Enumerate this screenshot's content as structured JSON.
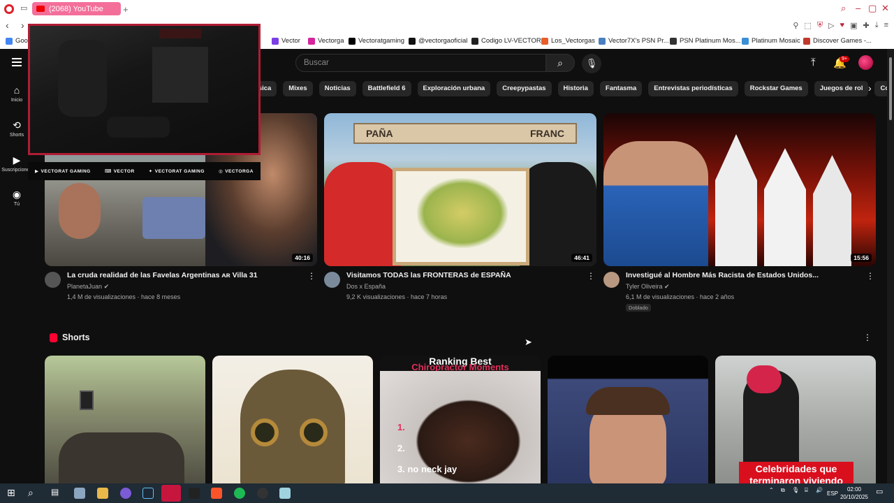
{
  "browser": {
    "tab_title": "(2068) YouTube",
    "new_tab": "+",
    "bookmarks": [
      {
        "label": "Goo",
        "color": "#4285f4"
      },
      {
        "label": "Vector",
        "color": "#7b3fe4"
      },
      {
        "label": "Vectorga",
        "color": "#d6249f"
      },
      {
        "label": "Vectoratgaming",
        "color": "#000000"
      },
      {
        "label": "@vectorgaoficial",
        "color": "#111111"
      },
      {
        "label": "Codigo LV-VECTOR",
        "color": "#222222"
      },
      {
        "label": "Los_Vectorgas",
        "color": "#e85d2a"
      },
      {
        "label": "Vector7X's PSN Pr...",
        "color": "#4a7fc1"
      },
      {
        "label": "PSN Platinum Mos...",
        "color": "#333333"
      },
      {
        "label": "Platinum Mosaic",
        "color": "#3a8fd6"
      },
      {
        "label": "Discover Games -...",
        "color": "#c0392b"
      }
    ]
  },
  "youtube": {
    "search_placeholder": "Buscar",
    "notifications_badge": "9+",
    "sidebar": [
      {
        "label": "Inicio",
        "icon": "home-icon"
      },
      {
        "label": "Shorts",
        "icon": "shorts-icon"
      },
      {
        "label": "Suscripciones",
        "icon": "subscriptions-icon"
      },
      {
        "label": "Tú",
        "icon": "you-icon"
      }
    ],
    "chips": [
      "úsica",
      "Mixes",
      "Noticias",
      "Battlefield 6",
      "Exploración urbana",
      "Creepypastas",
      "Historia",
      "Fantasma",
      "Entrevistas periodísticas",
      "Rockstar Games",
      "Juegos de rol",
      "Comedi"
    ],
    "videos": [
      {
        "title": "La cruda realidad de las Favelas Argentinas ᴀʀ Villa 31",
        "channel": "PlanetaJuan",
        "meta": "1,4 M de visualizaciones · hace 8 meses",
        "duration": "40:16",
        "badge": ""
      },
      {
        "title": "Visitamos TODAS las FRONTERAS de ESPAÑA",
        "channel": "Dos x España",
        "meta": "9,2 K visualizaciones · hace 7 horas",
        "duration": "46:41",
        "badge": "",
        "thumb_sign_left": "PAÑA",
        "thumb_sign_right": "FRANC"
      },
      {
        "title": "Investigué al Hombre Más Racista de Estados Unidos...",
        "channel": "Tyler Oliveira",
        "meta": "6,1 M de visualizaciones · hace 2 años",
        "duration": "15:56",
        "badge": "Doblado"
      }
    ],
    "shorts_title": "Shorts",
    "shorts": [
      {
        "text_top": "",
        "text_bottom": ""
      },
      {
        "text_top": "",
        "text_bottom": ""
      },
      {
        "text_top": "Ranking Best",
        "text_top2": "Chiropractor Moments",
        "list": [
          "1.",
          "2.",
          "3. no neck jay"
        ]
      },
      {
        "text_top": "",
        "text_bottom": ""
      },
      {
        "text_top": "",
        "text_bottom": "Celebridades que terminaron viviendo"
      }
    ]
  },
  "overlay": {
    "socials": [
      "VECTORAT GAMING",
      "VECTOR",
      "VECTORAT GAMING",
      "VECTORGA"
    ]
  },
  "taskbar": {
    "lang": "ESP",
    "time": "02:00",
    "date": "20/10/2025"
  }
}
